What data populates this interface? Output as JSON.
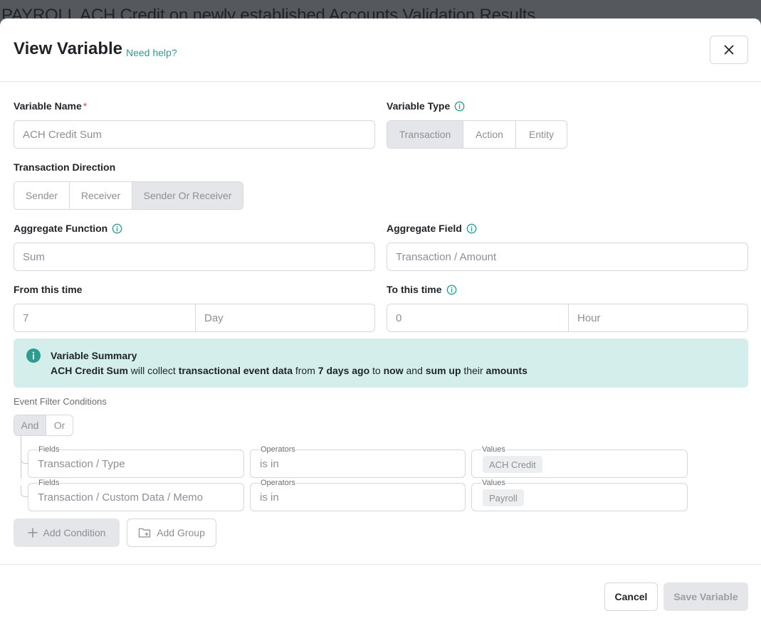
{
  "background": {
    "page_title": "PAYROLL ACH Credit on newly established Accounts Validation Results"
  },
  "modal": {
    "title": "View Variable",
    "help_link": "Need help?"
  },
  "variable_name": {
    "label": "Variable Name",
    "required_mark": "*",
    "value": "ACH Credit Sum"
  },
  "variable_type": {
    "label": "Variable Type",
    "options": [
      "Transaction",
      "Action",
      "Entity"
    ],
    "selected": "Transaction"
  },
  "transaction_direction": {
    "label": "Transaction Direction",
    "options": [
      "Sender",
      "Receiver",
      "Sender Or Receiver"
    ],
    "selected": "Sender Or Receiver"
  },
  "aggregate_function": {
    "label": "Aggregate Function",
    "value": "Sum"
  },
  "aggregate_field": {
    "label": "Aggregate Field",
    "value": "Transaction / Amount"
  },
  "from_time": {
    "label": "From this time",
    "amount": "7",
    "unit": "Day"
  },
  "to_time": {
    "label": "To this time",
    "amount": "0",
    "unit": "Hour"
  },
  "summary": {
    "title": "Variable Summary",
    "var_name": "ACH Credit Sum",
    "t1": " will collect ",
    "data_kind": "transactional event data",
    "t2": " from ",
    "from": "7 days ago",
    "t3": " to ",
    "to": "now",
    "t4": " and ",
    "operation": "sum up",
    "t5": " their ",
    "target": "amounts"
  },
  "event_filter": {
    "label": "Event Filter Conditions",
    "logic_options": [
      "And",
      "Or"
    ],
    "logic_selected": "And",
    "conditions": [
      {
        "fields_label": "Fields",
        "field": "Transaction / Type",
        "operators_label": "Operators",
        "operator": "is in",
        "values_label": "Values",
        "value": "ACH Credit"
      },
      {
        "fields_label": "Fields",
        "field": "Transaction / Custom Data / Memo",
        "operators_label": "Operators",
        "operator": "is in",
        "values_label": "Values",
        "value": "Payroll"
      }
    ],
    "add_condition": "Add Condition",
    "add_group": "Add Group"
  },
  "footer": {
    "cancel": "Cancel",
    "save": "Save Variable"
  },
  "colors": {
    "accent": "#2e9c8f",
    "summary_bg": "#d4eeec",
    "required": "#e5484d"
  }
}
